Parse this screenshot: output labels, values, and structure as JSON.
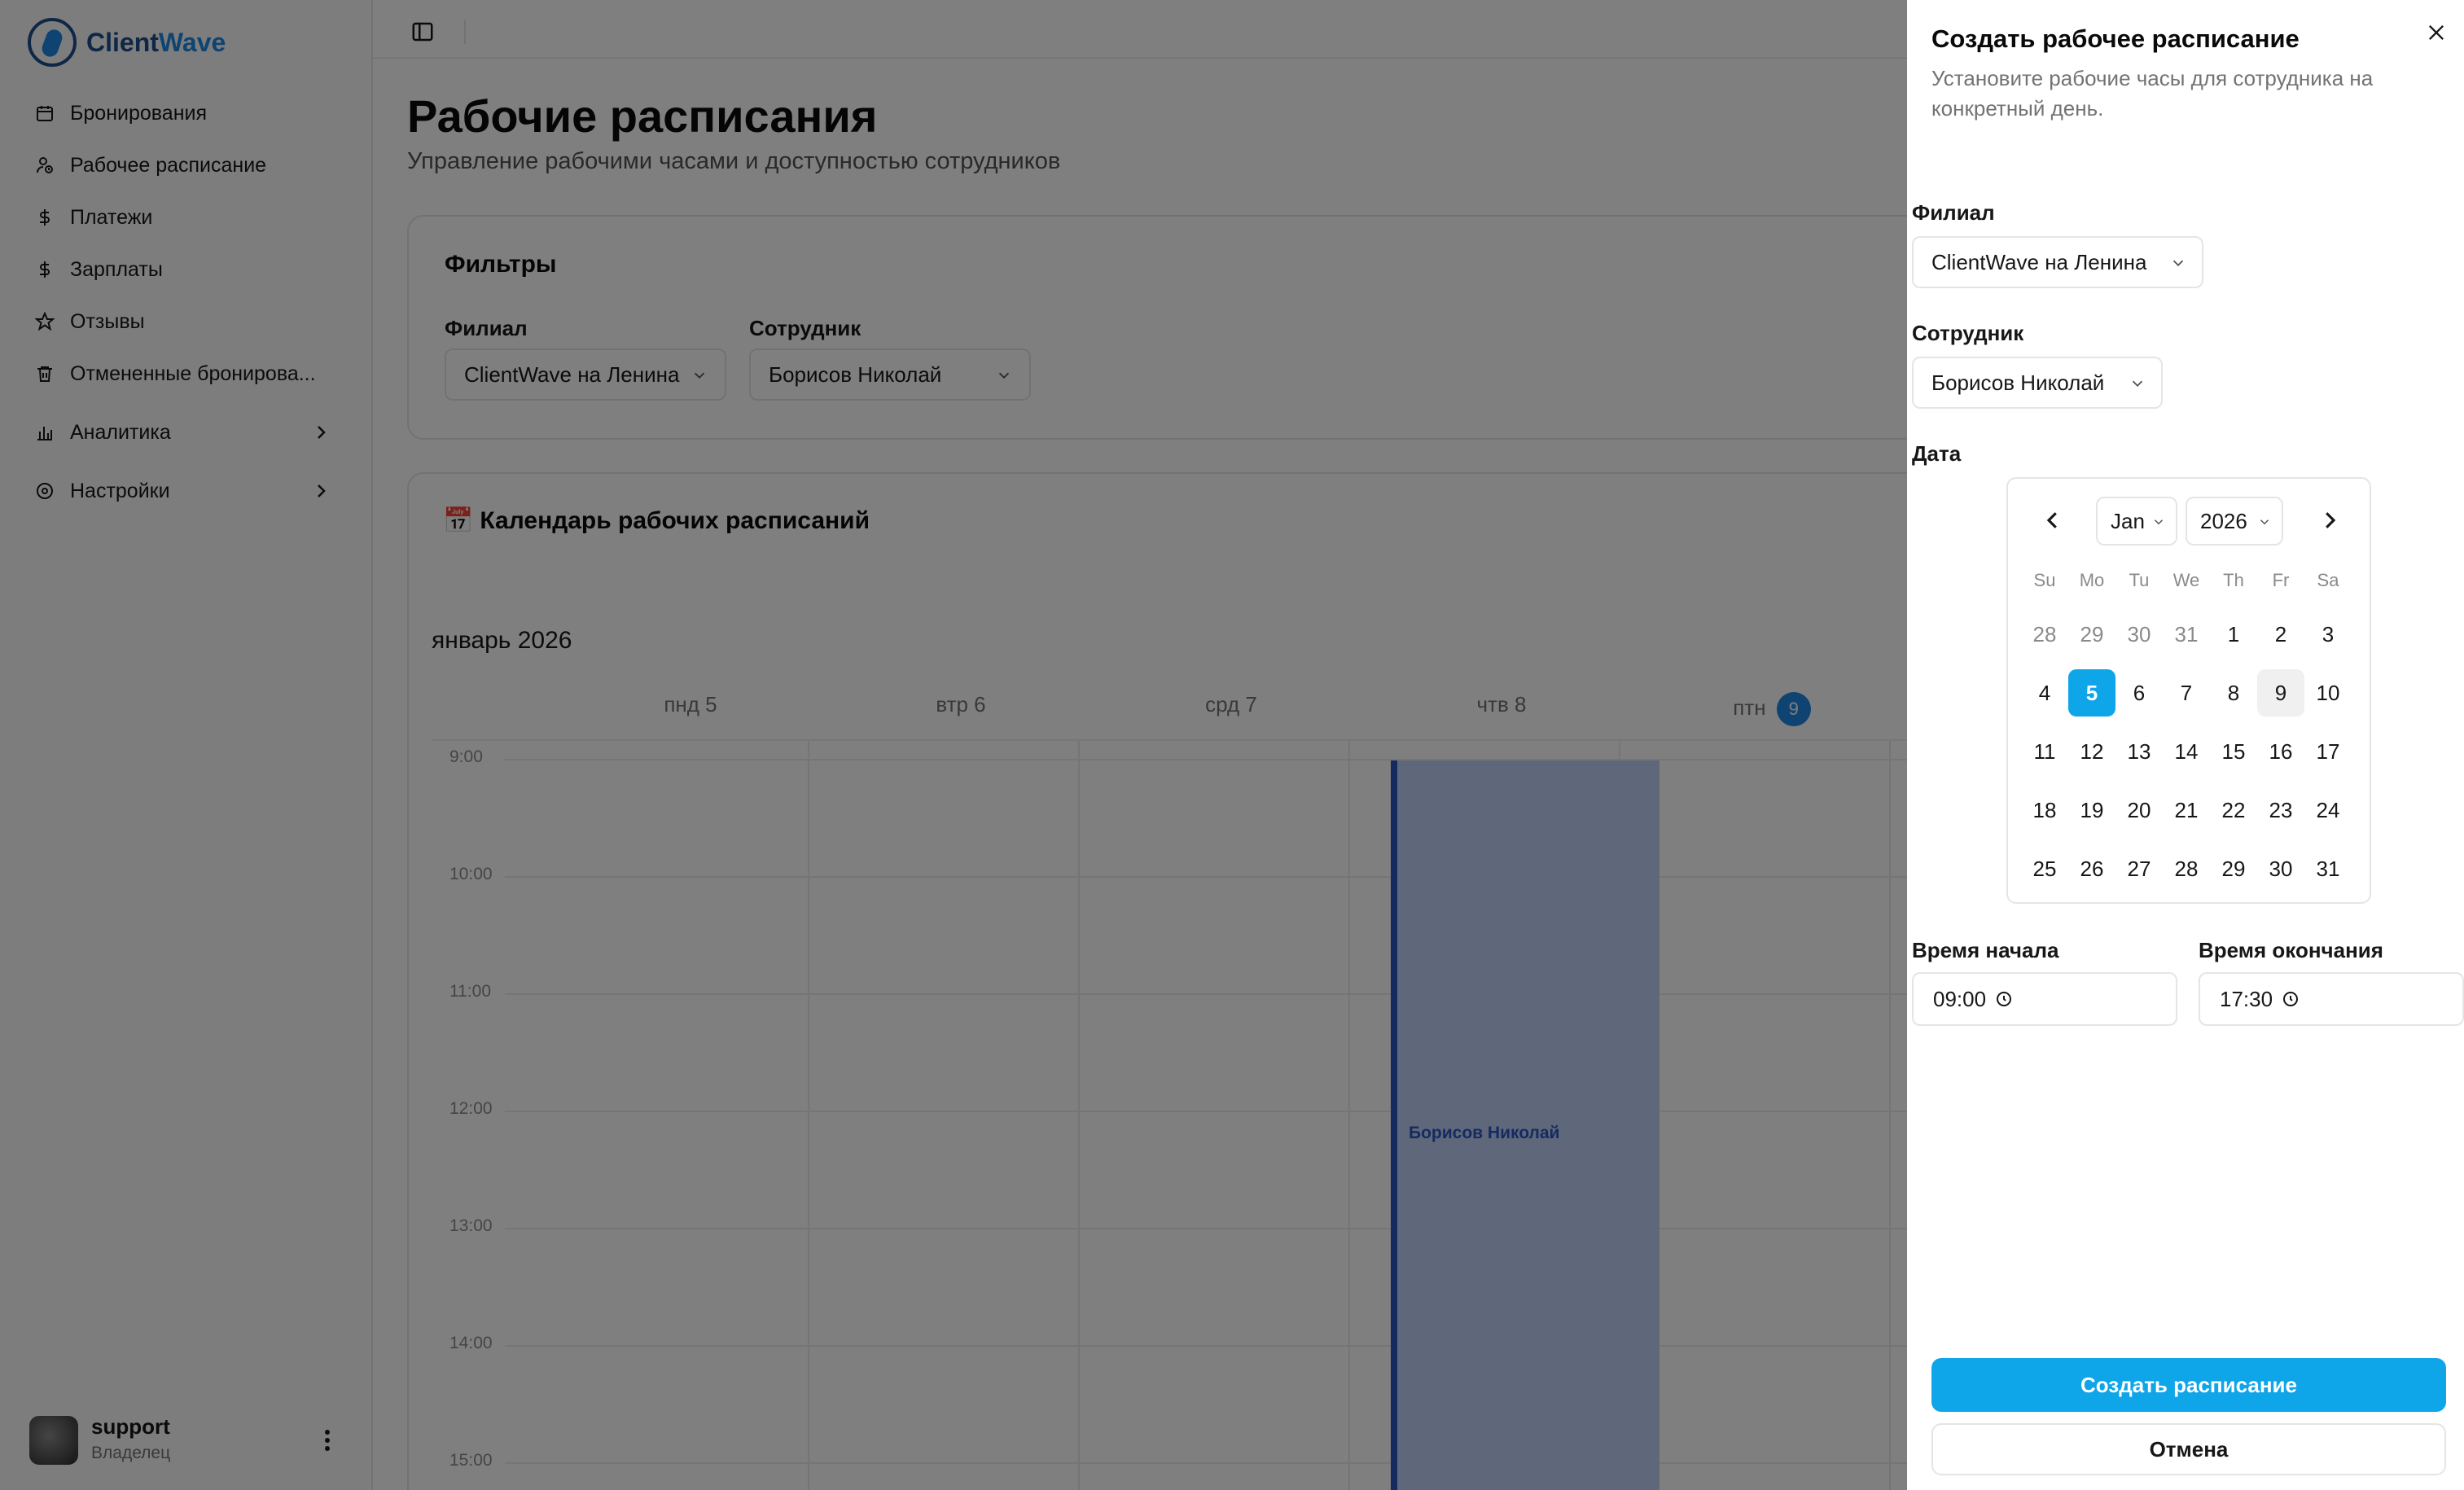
{
  "app": {
    "logo_brand_a": "Client",
    "logo_brand_b": "Wave"
  },
  "sidebar": {
    "items": [
      {
        "label": "Бронирования",
        "icon": "calendar-icon"
      },
      {
        "label": "Рабочее расписание",
        "icon": "user-clock-icon"
      },
      {
        "label": "Платежи",
        "icon": "dollar-icon"
      },
      {
        "label": "Зарплаты",
        "icon": "dollar-icon"
      },
      {
        "label": "Отзывы",
        "icon": "star-icon"
      },
      {
        "label": "Отмененные бронирова...",
        "icon": "trash-icon"
      },
      {
        "label": "Аналитика",
        "icon": "bar-chart-icon"
      },
      {
        "label": "Настройки",
        "icon": "gear-icon"
      }
    ],
    "user": {
      "name": "support",
      "role": "Владелец"
    }
  },
  "page": {
    "title": "Рабочие расписания",
    "subtitle": "Управление рабочими часами и доступностью сотрудников"
  },
  "filters": {
    "title": "Фильтры",
    "branch_label": "Филиал",
    "branch_value": "ClientWave на Ленина",
    "employee_label": "Сотрудник",
    "employee_value": "Борисов Николай"
  },
  "calendar": {
    "emoji": "📅",
    "title": "Календарь рабочих расписаний",
    "month": "январь 2026",
    "days": [
      {
        "label": "пнд 5"
      },
      {
        "label": "втр 6"
      },
      {
        "label": "срд 7"
      },
      {
        "label": "чтв 8"
      },
      {
        "label": "птн",
        "today": "9"
      }
    ],
    "hours": [
      "9:00",
      "10:00",
      "11:00",
      "12:00",
      "13:00",
      "14:00",
      "15:00"
    ],
    "event_label": "Борисов Николай"
  },
  "drawer": {
    "title": "Создать рабочее расписание",
    "description": "Установите рабочие часы для сотрудника на конкретный день.",
    "branch_label": "Филиал",
    "branch_value": "ClientWave на Ленина",
    "employee_label": "Сотрудник",
    "employee_value": "Борисов Николай",
    "date_label": "Дата",
    "picker": {
      "month": "Jan",
      "year": "2026",
      "weekdays": [
        "Su",
        "Mo",
        "Tu",
        "We",
        "Th",
        "Fr",
        "Sa"
      ],
      "weeks": [
        [
          "28",
          "29",
          "30",
          "31",
          "1",
          "2",
          "3"
        ],
        [
          "4",
          "5",
          "6",
          "7",
          "8",
          "9",
          "10"
        ],
        [
          "11",
          "12",
          "13",
          "14",
          "15",
          "16",
          "17"
        ],
        [
          "18",
          "19",
          "20",
          "21",
          "22",
          "23",
          "24"
        ],
        [
          "25",
          "26",
          "27",
          "28",
          "29",
          "30",
          "31"
        ]
      ],
      "selected": "5",
      "today": "9"
    },
    "start_label": "Время начала",
    "start_value": "09:00",
    "end_label": "Время окончания",
    "end_value": "17:30",
    "create_label": "Создать расписание",
    "cancel_label": "Отмена"
  },
  "colors": {
    "accent": "#0ea5e9",
    "event_fill": "#bcd0f5",
    "event_border": "#2b55c2",
    "today_badge": "#1e88e5"
  }
}
